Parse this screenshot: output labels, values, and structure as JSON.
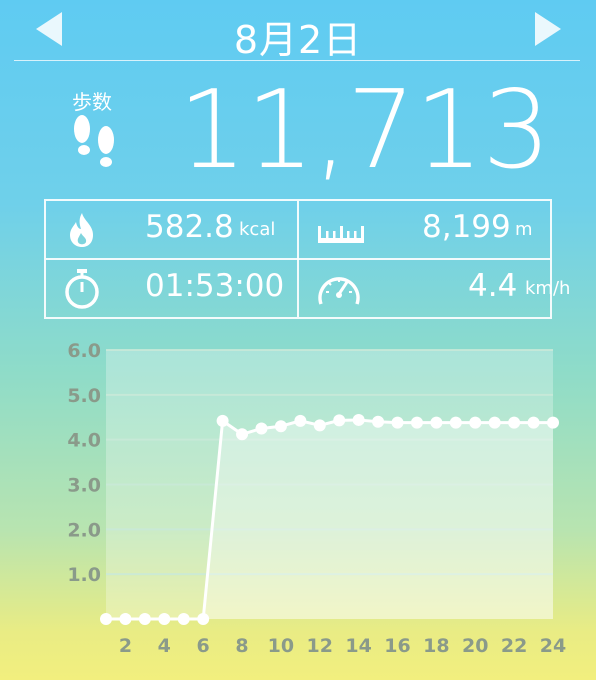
{
  "header": {
    "date": "8月2日"
  },
  "steps": {
    "label": "歩数",
    "value": "11,713"
  },
  "stats": {
    "calories": {
      "value": "582.8",
      "unit": "kcal"
    },
    "distance": {
      "value": "8,199",
      "unit": "m"
    },
    "time": {
      "value": "01:53:00"
    },
    "speed": {
      "value": "4.4",
      "unit": "km/h"
    }
  },
  "colors": {
    "tick": "#8a9a8a",
    "grid": "#c9e9d8",
    "accent": "#ffffff"
  },
  "chart_data": {
    "type": "line",
    "x": [
      1,
      2,
      3,
      4,
      5,
      6,
      7,
      8,
      9,
      10,
      11,
      12,
      13,
      14,
      15,
      16,
      17,
      18,
      19,
      20,
      21,
      22,
      23,
      24
    ],
    "values": [
      0,
      0,
      0,
      0,
      0,
      0,
      4.42,
      4.12,
      4.25,
      4.3,
      4.42,
      4.32,
      4.43,
      4.44,
      4.4,
      4.38,
      4.38,
      4.38,
      4.38,
      4.38,
      4.38,
      4.38,
      4.38,
      4.38
    ],
    "xticks": [
      "2",
      "4",
      "6",
      "8",
      "10",
      "12",
      "14",
      "16",
      "18",
      "20",
      "22",
      "24"
    ],
    "yticks": [
      "1.0",
      "2.0",
      "3.0",
      "4.0",
      "5.0",
      "6.0"
    ],
    "ylim": [
      0,
      6.0
    ],
    "xlim": [
      1,
      24
    ],
    "grid": true
  }
}
